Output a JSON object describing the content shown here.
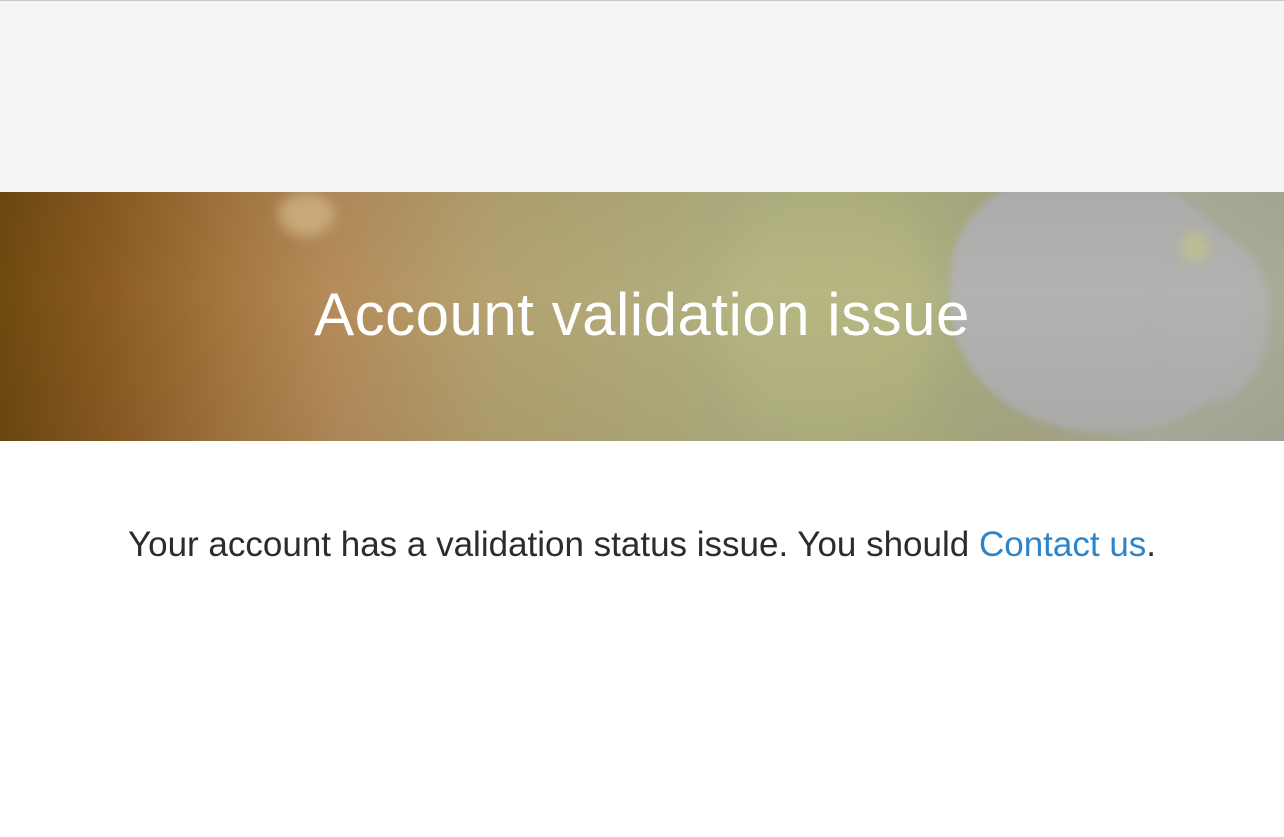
{
  "hero": {
    "title": "Account validation issue"
  },
  "message": {
    "text": "Your account has a validation status issue. You should ",
    "link_label": "Contact us",
    "suffix": "."
  },
  "colors": {
    "link": "#2d85c9",
    "top_band": "#f5f5f5",
    "body_text": "#2c2c2c"
  }
}
